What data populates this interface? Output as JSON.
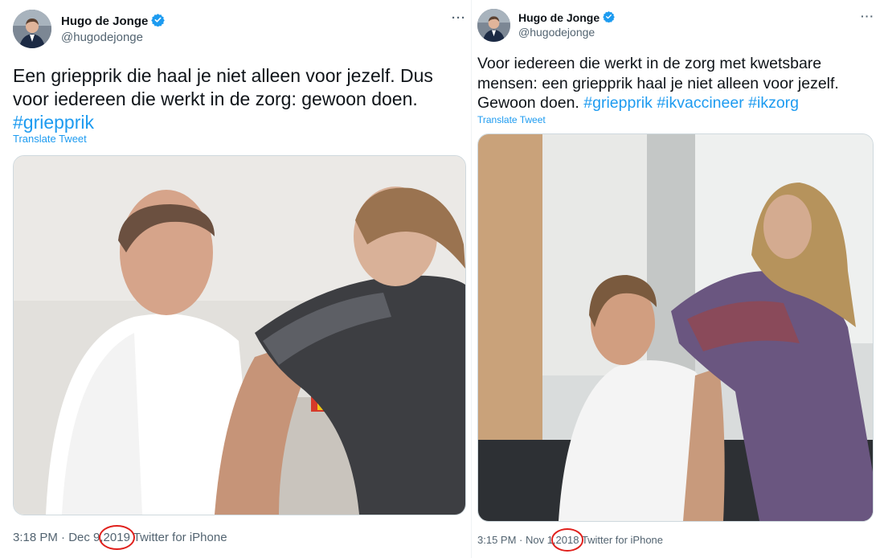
{
  "tweets": [
    {
      "display_name": "Hugo de Jonge",
      "handle": "@hugodejonge",
      "text_plain": "Een griepprik die haal je niet alleen voor jezelf. Dus voor iedereen die werkt in de zorg: gewoon doen. ",
      "hashtags": [
        "#griepprik"
      ],
      "translate_label": "Translate Tweet",
      "time": "3:18 PM · Dec 9,",
      "year": "2019",
      "source": "Twitter for iPhone",
      "more_icon": "more-horizontal-icon",
      "verified_icon": "verified-badge-icon"
    },
    {
      "display_name": "Hugo de Jonge",
      "handle": "@hugodejonge",
      "text_plain": "Voor iedereen die werkt in de zorg met kwetsbare mensen: een griepprik haal je niet alleen voor jezelf. Gewoon doen. ",
      "hashtags": [
        "#griepprik",
        "#ikvaccineer",
        "#ikzorg"
      ],
      "translate_label": "Translate Tweet",
      "time": "3:15 PM · Nov 1,",
      "year": "2018",
      "source": "Twitter for iPhone",
      "more_icon": "more-horizontal-icon",
      "verified_icon": "verified-badge-icon"
    }
  ],
  "colors": {
    "link": "#1d9bf0",
    "secondary_text": "#536471",
    "annotation_circle": "#e0201c"
  }
}
